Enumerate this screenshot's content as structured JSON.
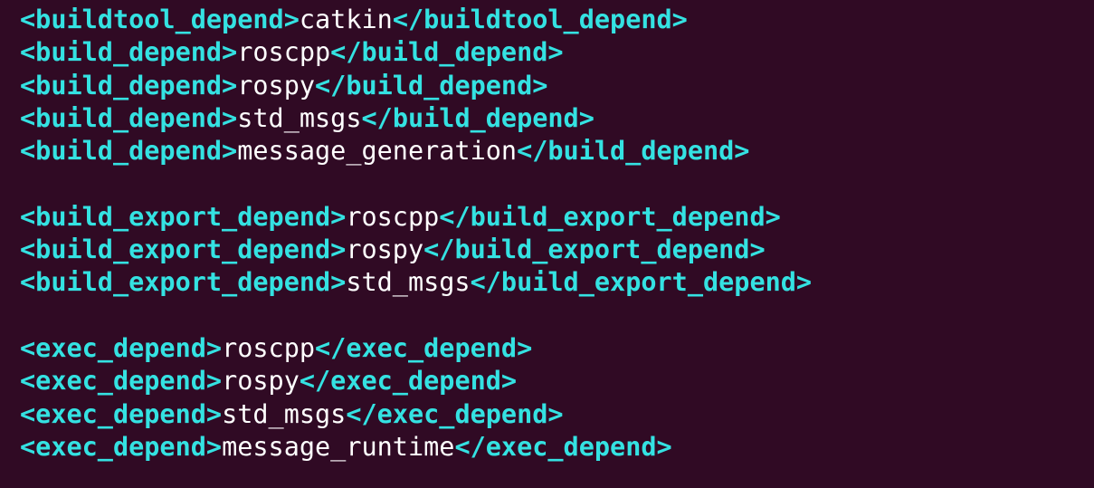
{
  "colors": {
    "background": "#300a24",
    "tag": "#34e2e2",
    "text": "#ffffff"
  },
  "lines": [
    {
      "open": "<buildtool_depend>",
      "value": "catkin",
      "close": "</buildtool_depend>"
    },
    {
      "open": "<build_depend>",
      "value": "roscpp",
      "close": "</build_depend>"
    },
    {
      "open": "<build_depend>",
      "value": "rospy",
      "close": "</build_depend>"
    },
    {
      "open": "<build_depend>",
      "value": "std_msgs",
      "close": "</build_depend>"
    },
    {
      "open": "<build_depend>",
      "value": "message_generation",
      "close": "</build_depend>"
    },
    {
      "open": "",
      "value": "",
      "close": ""
    },
    {
      "open": "<build_export_depend>",
      "value": "roscpp",
      "close": "</build_export_depend>"
    },
    {
      "open": "<build_export_depend>",
      "value": "rospy",
      "close": "</build_export_depend>"
    },
    {
      "open": "<build_export_depend>",
      "value": "std_msgs",
      "close": "</build_export_depend>"
    },
    {
      "open": "",
      "value": "",
      "close": ""
    },
    {
      "open": "<exec_depend>",
      "value": "roscpp",
      "close": "</exec_depend>"
    },
    {
      "open": "<exec_depend>",
      "value": "rospy",
      "close": "</exec_depend>"
    },
    {
      "open": "<exec_depend>",
      "value": "std_msgs",
      "close": "</exec_depend>"
    },
    {
      "open": "<exec_depend>",
      "value": "message_runtime",
      "close": "</exec_depend>"
    }
  ]
}
